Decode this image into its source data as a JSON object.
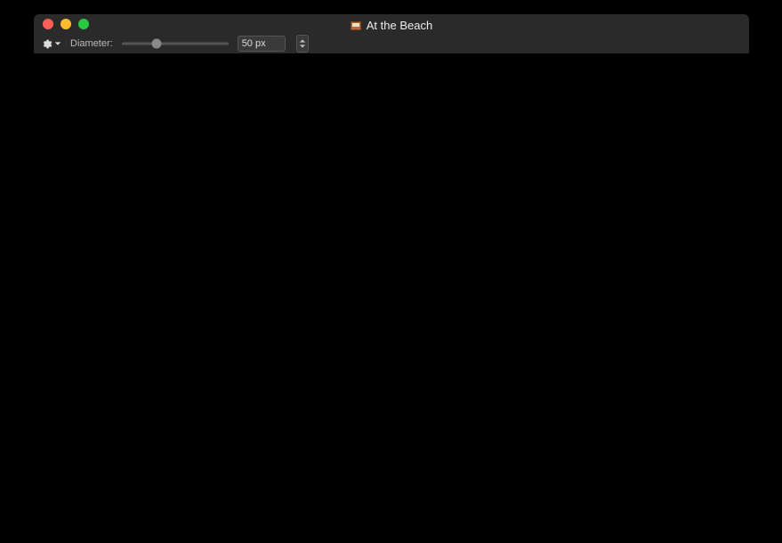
{
  "window": {
    "title": "At the Beach"
  },
  "toolbar": {
    "diameter_label": "Diameter:",
    "diameter_value": "50 px",
    "slider_percent": 33
  }
}
